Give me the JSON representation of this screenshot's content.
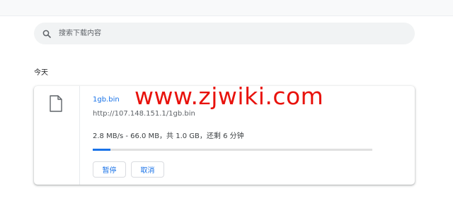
{
  "search": {
    "placeholder": "搜索下载内容",
    "icon": "search-icon"
  },
  "section": {
    "title": "今天"
  },
  "download": {
    "file_icon": "file-icon",
    "name": "1gb.bin",
    "url": "http://107.148.151.1/1gb.bin",
    "status": "2.8 MB/s - 66.0 MB，共 1.0 GB，还剩 6 分钟",
    "progress_fraction": 0.064,
    "progress_color": "#1a73e8",
    "pause_label": "暂停",
    "cancel_label": "取消"
  },
  "watermark": {
    "text": "www.zjwiki.com",
    "color": "#e8120c"
  },
  "colors": {
    "accent": "#1a73e8",
    "search_bg": "#f1f3f4"
  }
}
